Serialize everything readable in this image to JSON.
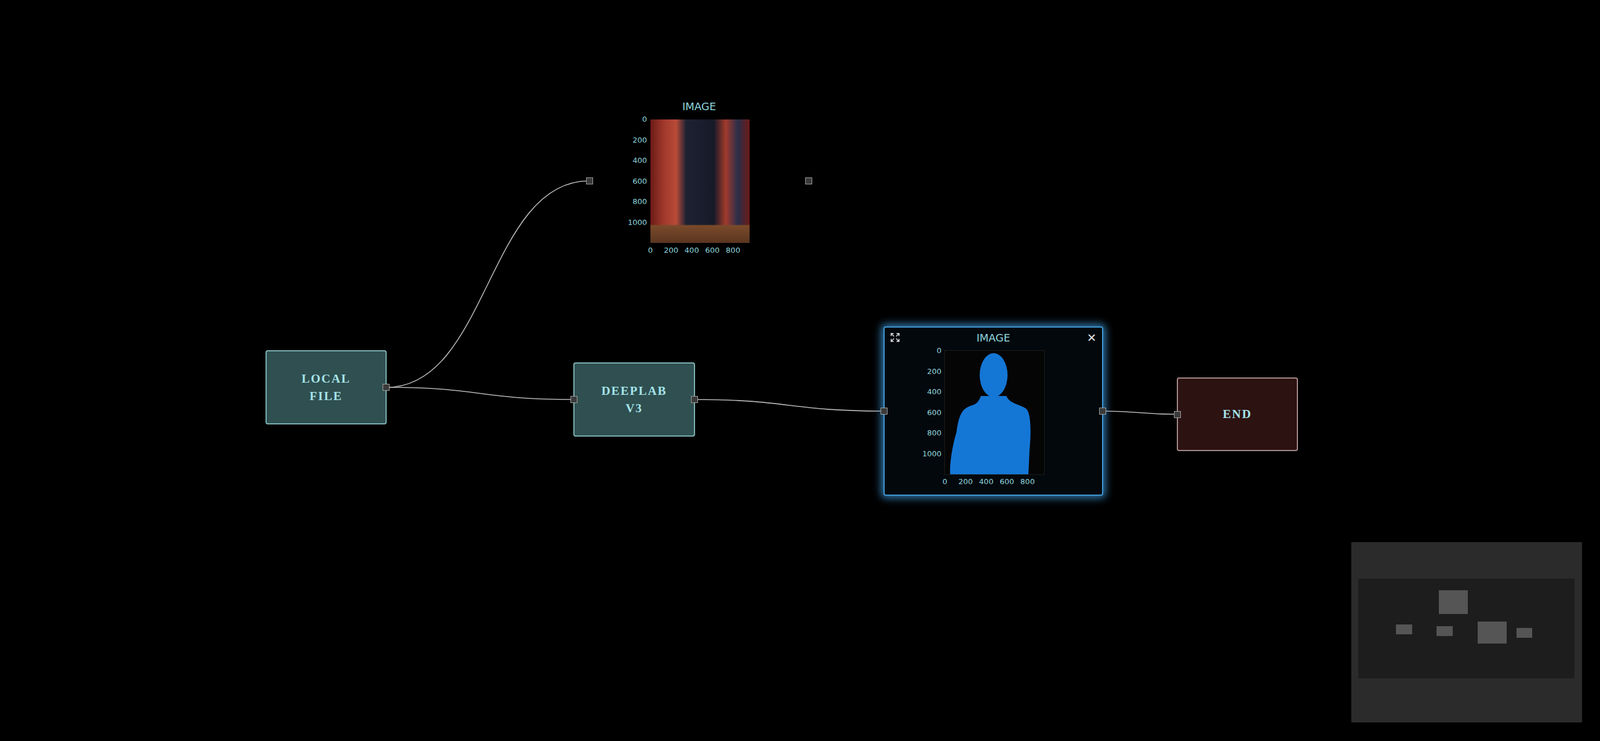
{
  "nodes": [
    {
      "label": "LOCAL FILE",
      "kind": "source",
      "selected": false
    },
    {
      "label": "DEEPLAB V3",
      "kind": "model",
      "selected": false
    },
    {
      "label": "IMAGE",
      "kind": "viewer",
      "selected": false,
      "content": "photo",
      "x_ticks": [
        "0",
        "200",
        "400",
        "600",
        "800"
      ],
      "y_ticks": [
        "0",
        "200",
        "400",
        "600",
        "800",
        "1000"
      ]
    },
    {
      "label": "IMAGE",
      "kind": "viewer",
      "selected": true,
      "content": "mask",
      "close": "×",
      "x_ticks": [
        "0",
        "200",
        "400",
        "600",
        "800"
      ],
      "y_ticks": [
        "0",
        "200",
        "400",
        "600",
        "800",
        "1000"
      ]
    },
    {
      "label": "END",
      "kind": "sink",
      "selected": false
    }
  ],
  "edges": [
    [
      0,
      2
    ],
    [
      0,
      1
    ],
    [
      1,
      3
    ],
    [
      3,
      4
    ]
  ],
  "minimap": {
    "visible": true
  }
}
